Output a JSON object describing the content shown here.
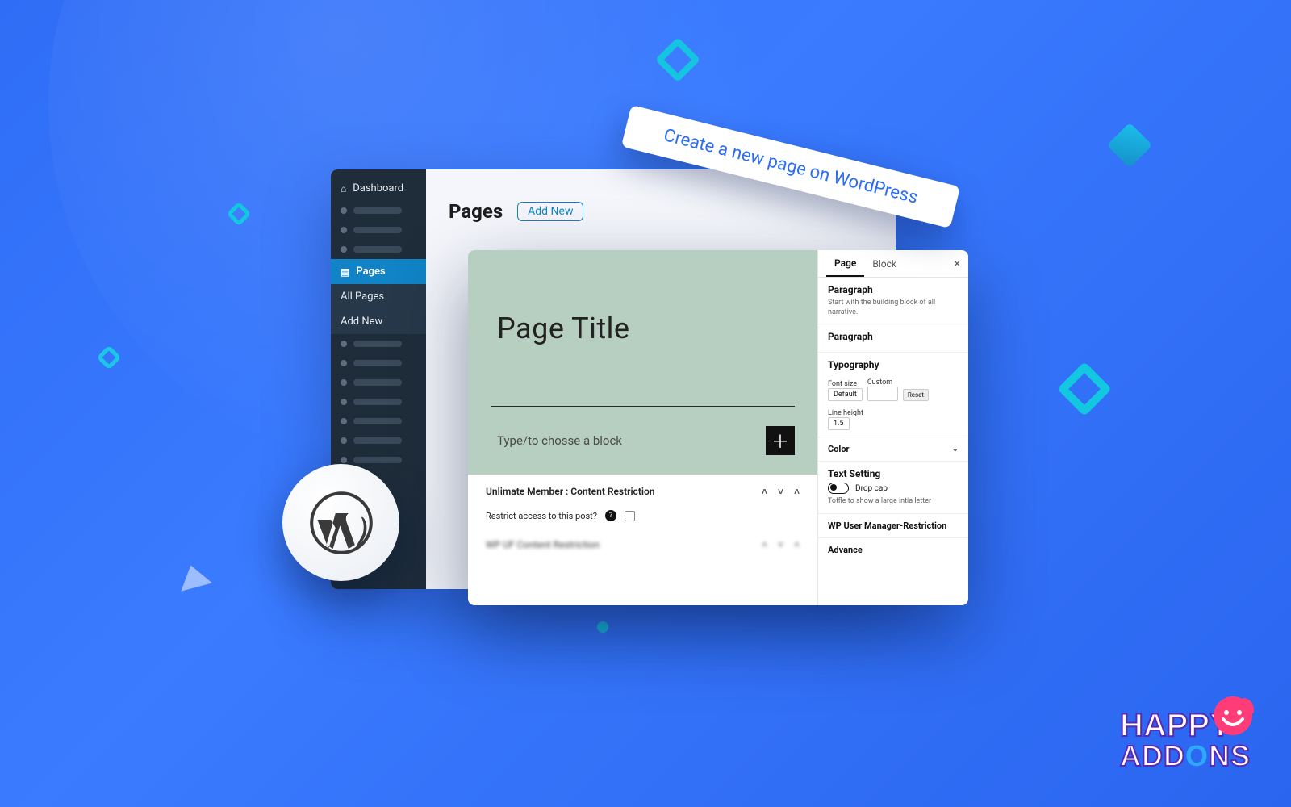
{
  "callout": "Create a new page on WordPress",
  "wp_admin": {
    "sidebar": {
      "dashboard": "Dashboard",
      "pages": "Pages",
      "all_pages": "All Pages",
      "add_new": "Add New"
    },
    "body": {
      "heading": "Pages",
      "add_new_btn": "Add New"
    }
  },
  "editor": {
    "title_placeholder": "Page Title",
    "type_placeholder": "Type/to chosse a block",
    "metabox1_title": "Unlimate Member : Content Restriction",
    "restrict_label": "Restrict access to this post?",
    "metabox2_title": "WP UF Content Restriction"
  },
  "inspector": {
    "tab_page": "Page",
    "tab_block": "Block",
    "paragraph_h": "Paragraph",
    "paragraph_sub": "Start with the building block of all narrative.",
    "paragraph_h2": "Paragraph",
    "typography_h": "Typography",
    "font_size_lbl": "Font size",
    "custom_lbl": "Custom",
    "default_opt": "Default",
    "reset_btn": "Reset",
    "lineheight_lbl": "Line height",
    "lineheight_val": "1.5",
    "color_h": "Color",
    "text_setting_h": "Text Setting",
    "drop_cap": "Drop cap",
    "drop_cap_sub": "Toffle to show a large  intia letter",
    "wp_user_mgr": "WP User Manager-Restriction",
    "advance": "Advance"
  },
  "brand": {
    "line1": "HAPPY",
    "line2a": "ADD",
    "line2b": "O",
    "line2c": "NS"
  }
}
